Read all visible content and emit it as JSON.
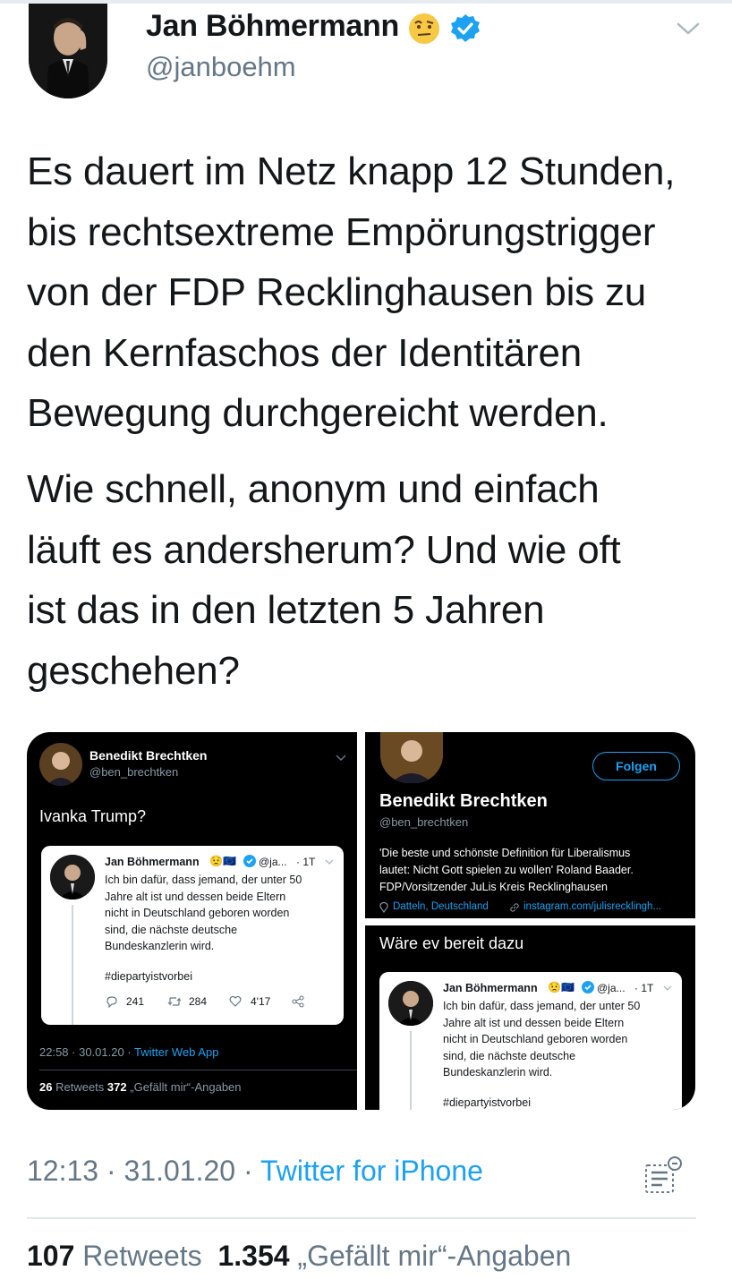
{
  "author": {
    "name": "Jan Böhmermann",
    "handle": "@janboehm"
  },
  "tweet": {
    "paragraph1": [
      "Es dauert im Netz knapp 12 Stunden,",
      "bis rechtsextreme Empörungstrigger",
      "von der FDP Recklinghausen bis zu",
      "den Kernfaschos der Identitären",
      "Bewegung durchgereicht werden."
    ],
    "paragraph2": [
      "Wie schnell, anonym und einfach",
      "läuft es andersherum? Und wie oft",
      "ist das in den letzten 5 Jahren",
      "geschehen?"
    ]
  },
  "media": {
    "left": {
      "author_name": "Benedikt Brechtken",
      "author_handle": "@ben_brechtken",
      "text": "Ivanka Trump?",
      "quoted": {
        "name": "Jan Böhmermann",
        "handle_trunc": "@ja...",
        "age": "· 1T",
        "lines": [
          "Ich bin dafür, dass jemand, der unter 50",
          "Jahre alt ist und dessen beide Eltern",
          "nicht in Deutschland geboren worden",
          "sind, die nächste deutsche",
          "Bundeskanzlerin wird."
        ],
        "hashtag": "#diepartyistvorbei",
        "replies": "241",
        "retweets": "284",
        "likes": "4'17"
      },
      "timestamp": "22:58 · 30.01.20 · ",
      "source": "Twitter Web App",
      "rt_count": "26",
      "rt_label": "Retweets",
      "like_count": "372",
      "like_label": "„Gefällt mir“-Angaben"
    },
    "right_top": {
      "follow_label": "Folgen",
      "name": "Benedikt Brechtken",
      "handle": "@ben_brechtken",
      "bio": [
        "'Die beste und schönste Definition für Liberalismus",
        "lautet: Nicht Gott spielen zu wollen' Roland Baader.",
        "FDP/Vorsitzender JuLis Kreis Recklinghausen"
      ],
      "location": "Datteln, Deutschland",
      "link": "instagram.com/julisrecklingh..."
    },
    "right_bottom": {
      "text": "Wäre ev bereit dazu",
      "quoted": {
        "name": "Jan Böhmermann",
        "handle_trunc": "@ja...",
        "age": "· 1T",
        "lines": [
          "Ich bin dafür, dass jemand, der unter 50",
          "Jahre alt ist und dessen beide Eltern",
          "nicht in Deutschland geboren worden",
          "sind, die nächste deutsche",
          "Bundeskanzlerin wird."
        ],
        "hashtag": "#diepartyistvorbei"
      }
    }
  },
  "footer": {
    "time": "12:13 · 31.01.20 · ",
    "source": "Twitter for iPhone",
    "retweet_count": "107",
    "retweet_label": "Retweets",
    "like_count": "1.354",
    "like_label": "„Gefällt mir“-Angaben"
  },
  "colors": {
    "accent": "#1da1f2",
    "secondary_text": "#657786",
    "divider": "#e1e8ed"
  }
}
